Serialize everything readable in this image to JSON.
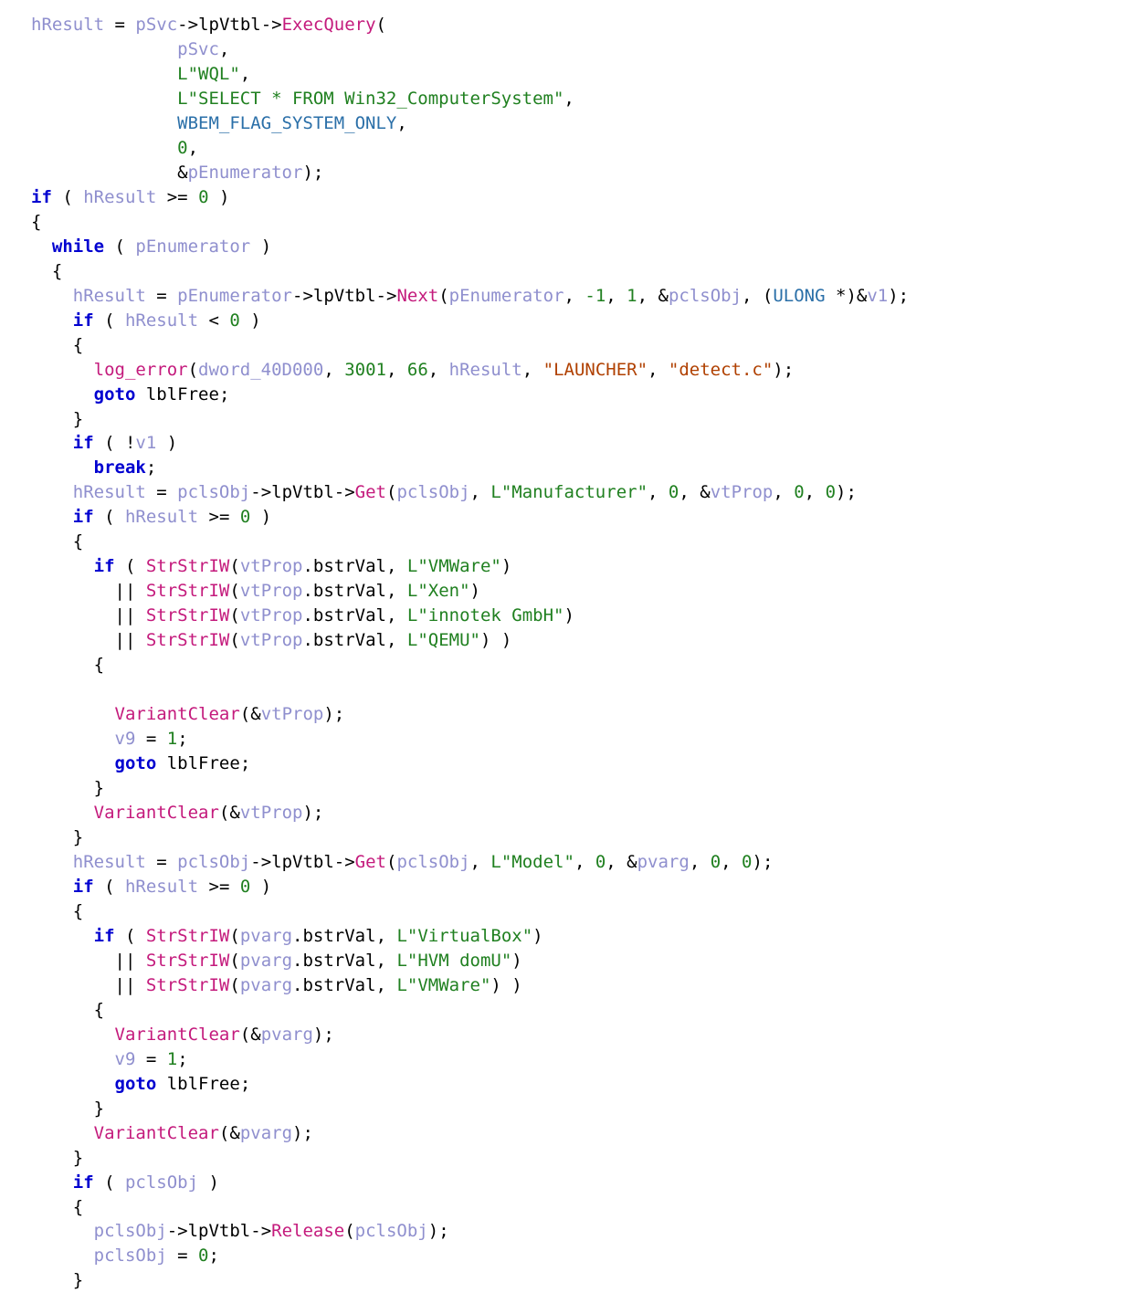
{
  "code": {
    "lines": [
      [
        {
          "t": "v",
          "s": "hResult"
        },
        {
          "t": "op",
          "s": " = "
        },
        {
          "t": "v",
          "s": "pSvc"
        },
        {
          "t": "op",
          "s": "->"
        },
        {
          "t": "mem",
          "s": "lpVtbl"
        },
        {
          "t": "op",
          "s": "->"
        },
        {
          "t": "fn",
          "s": "ExecQuery"
        },
        {
          "t": "op",
          "s": "("
        }
      ],
      [
        {
          "t": "op",
          "s": "              "
        },
        {
          "t": "v",
          "s": "pSvc"
        },
        {
          "t": "op",
          "s": ","
        }
      ],
      [
        {
          "t": "op",
          "s": "              "
        },
        {
          "t": "str",
          "s": "L\"WQL\""
        },
        {
          "t": "op",
          "s": ","
        }
      ],
      [
        {
          "t": "op",
          "s": "              "
        },
        {
          "t": "str",
          "s": "L\"SELECT * FROM Win32_ComputerSystem\""
        },
        {
          "t": "op",
          "s": ","
        }
      ],
      [
        {
          "t": "op",
          "s": "              "
        },
        {
          "t": "mac",
          "s": "WBEM_FLAG_SYSTEM_ONLY"
        },
        {
          "t": "op",
          "s": ","
        }
      ],
      [
        {
          "t": "op",
          "s": "              "
        },
        {
          "t": "num",
          "s": "0"
        },
        {
          "t": "op",
          "s": ","
        }
      ],
      [
        {
          "t": "op",
          "s": "              &"
        },
        {
          "t": "v",
          "s": "pEnumerator"
        },
        {
          "t": "op",
          "s": ");"
        }
      ],
      [
        {
          "t": "kw",
          "s": "if"
        },
        {
          "t": "op",
          "s": " ( "
        },
        {
          "t": "v",
          "s": "hResult"
        },
        {
          "t": "op",
          "s": " >= "
        },
        {
          "t": "num",
          "s": "0"
        },
        {
          "t": "op",
          "s": " )"
        }
      ],
      [
        {
          "t": "op",
          "s": "{"
        }
      ],
      [
        {
          "t": "op",
          "s": "  "
        },
        {
          "t": "kw",
          "s": "while"
        },
        {
          "t": "op",
          "s": " ( "
        },
        {
          "t": "v",
          "s": "pEnumerator"
        },
        {
          "t": "op",
          "s": " )"
        }
      ],
      [
        {
          "t": "op",
          "s": "  {"
        }
      ],
      [
        {
          "t": "op",
          "s": "    "
        },
        {
          "t": "v",
          "s": "hResult"
        },
        {
          "t": "op",
          "s": " = "
        },
        {
          "t": "v",
          "s": "pEnumerator"
        },
        {
          "t": "op",
          "s": "->"
        },
        {
          "t": "mem",
          "s": "lpVtbl"
        },
        {
          "t": "op",
          "s": "->"
        },
        {
          "t": "fn",
          "s": "Next"
        },
        {
          "t": "op",
          "s": "("
        },
        {
          "t": "v",
          "s": "pEnumerator"
        },
        {
          "t": "op",
          "s": ", "
        },
        {
          "t": "num",
          "s": "-1"
        },
        {
          "t": "op",
          "s": ", "
        },
        {
          "t": "num",
          "s": "1"
        },
        {
          "t": "op",
          "s": ", &"
        },
        {
          "t": "v",
          "s": "pclsObj"
        },
        {
          "t": "op",
          "s": ", ("
        },
        {
          "t": "ty",
          "s": "ULONG"
        },
        {
          "t": "op",
          "s": " *)&"
        },
        {
          "t": "v",
          "s": "v1"
        },
        {
          "t": "op",
          "s": ");"
        }
      ],
      [
        {
          "t": "op",
          "s": "    "
        },
        {
          "t": "kw",
          "s": "if"
        },
        {
          "t": "op",
          "s": " ( "
        },
        {
          "t": "v",
          "s": "hResult"
        },
        {
          "t": "op",
          "s": " < "
        },
        {
          "t": "num",
          "s": "0"
        },
        {
          "t": "op",
          "s": " )"
        }
      ],
      [
        {
          "t": "op",
          "s": "    {"
        }
      ],
      [
        {
          "t": "op",
          "s": "      "
        },
        {
          "t": "fn",
          "s": "log_error"
        },
        {
          "t": "op",
          "s": "("
        },
        {
          "t": "v",
          "s": "dword_40D000"
        },
        {
          "t": "op",
          "s": ", "
        },
        {
          "t": "num",
          "s": "3001"
        },
        {
          "t": "op",
          "s": ", "
        },
        {
          "t": "num",
          "s": "66"
        },
        {
          "t": "op",
          "s": ", "
        },
        {
          "t": "v",
          "s": "hResult"
        },
        {
          "t": "op",
          "s": ", "
        },
        {
          "t": "sstr",
          "s": "\"LAUNCHER\""
        },
        {
          "t": "op",
          "s": ", "
        },
        {
          "t": "sstr",
          "s": "\"detect.c\""
        },
        {
          "t": "op",
          "s": ");"
        }
      ],
      [
        {
          "t": "op",
          "s": "      "
        },
        {
          "t": "kw",
          "s": "goto"
        },
        {
          "t": "op",
          "s": " "
        },
        {
          "t": "lbl",
          "s": "lblFree"
        },
        {
          "t": "op",
          "s": ";"
        }
      ],
      [
        {
          "t": "op",
          "s": "    }"
        }
      ],
      [
        {
          "t": "op",
          "s": "    "
        },
        {
          "t": "kw",
          "s": "if"
        },
        {
          "t": "op",
          "s": " ( !"
        },
        {
          "t": "v",
          "s": "v1"
        },
        {
          "t": "op",
          "s": " )"
        }
      ],
      [
        {
          "t": "op",
          "s": "      "
        },
        {
          "t": "kw",
          "s": "break"
        },
        {
          "t": "op",
          "s": ";"
        }
      ],
      [
        {
          "t": "op",
          "s": "    "
        },
        {
          "t": "v",
          "s": "hResult"
        },
        {
          "t": "op",
          "s": " = "
        },
        {
          "t": "v",
          "s": "pclsObj"
        },
        {
          "t": "op",
          "s": "->"
        },
        {
          "t": "mem",
          "s": "lpVtbl"
        },
        {
          "t": "op",
          "s": "->"
        },
        {
          "t": "fn",
          "s": "Get"
        },
        {
          "t": "op",
          "s": "("
        },
        {
          "t": "v",
          "s": "pclsObj"
        },
        {
          "t": "op",
          "s": ", "
        },
        {
          "t": "str",
          "s": "L\"Manufacturer\""
        },
        {
          "t": "op",
          "s": ", "
        },
        {
          "t": "num",
          "s": "0"
        },
        {
          "t": "op",
          "s": ", &"
        },
        {
          "t": "v",
          "s": "vtProp"
        },
        {
          "t": "op",
          "s": ", "
        },
        {
          "t": "num",
          "s": "0"
        },
        {
          "t": "op",
          "s": ", "
        },
        {
          "t": "num",
          "s": "0"
        },
        {
          "t": "op",
          "s": ");"
        }
      ],
      [
        {
          "t": "op",
          "s": "    "
        },
        {
          "t": "kw",
          "s": "if"
        },
        {
          "t": "op",
          "s": " ( "
        },
        {
          "t": "v",
          "s": "hResult"
        },
        {
          "t": "op",
          "s": " >= "
        },
        {
          "t": "num",
          "s": "0"
        },
        {
          "t": "op",
          "s": " )"
        }
      ],
      [
        {
          "t": "op",
          "s": "    {"
        }
      ],
      [
        {
          "t": "op",
          "s": "      "
        },
        {
          "t": "kw",
          "s": "if"
        },
        {
          "t": "op",
          "s": " ( "
        },
        {
          "t": "fn",
          "s": "StrStrIW"
        },
        {
          "t": "op",
          "s": "("
        },
        {
          "t": "v",
          "s": "vtProp"
        },
        {
          "t": "op",
          "s": "."
        },
        {
          "t": "mem",
          "s": "bstrVal"
        },
        {
          "t": "op",
          "s": ", "
        },
        {
          "t": "str",
          "s": "L\"VMWare\""
        },
        {
          "t": "op",
          "s": ")"
        }
      ],
      [
        {
          "t": "op",
          "s": "        || "
        },
        {
          "t": "fn",
          "s": "StrStrIW"
        },
        {
          "t": "op",
          "s": "("
        },
        {
          "t": "v",
          "s": "vtProp"
        },
        {
          "t": "op",
          "s": "."
        },
        {
          "t": "mem",
          "s": "bstrVal"
        },
        {
          "t": "op",
          "s": ", "
        },
        {
          "t": "str",
          "s": "L\"Xen\""
        },
        {
          "t": "op",
          "s": ")"
        }
      ],
      [
        {
          "t": "op",
          "s": "        || "
        },
        {
          "t": "fn",
          "s": "StrStrIW"
        },
        {
          "t": "op",
          "s": "("
        },
        {
          "t": "v",
          "s": "vtProp"
        },
        {
          "t": "op",
          "s": "."
        },
        {
          "t": "mem",
          "s": "bstrVal"
        },
        {
          "t": "op",
          "s": ", "
        },
        {
          "t": "str",
          "s": "L\"innotek GmbH\""
        },
        {
          "t": "op",
          "s": ")"
        }
      ],
      [
        {
          "t": "op",
          "s": "        || "
        },
        {
          "t": "fn",
          "s": "StrStrIW"
        },
        {
          "t": "op",
          "s": "("
        },
        {
          "t": "v",
          "s": "vtProp"
        },
        {
          "t": "op",
          "s": "."
        },
        {
          "t": "mem",
          "s": "bstrVal"
        },
        {
          "t": "op",
          "s": ", "
        },
        {
          "t": "str",
          "s": "L\"QEMU\""
        },
        {
          "t": "op",
          "s": ") )"
        }
      ],
      [
        {
          "t": "op",
          "s": "      {"
        }
      ],
      [
        {
          "t": "op",
          "s": ""
        }
      ],
      [
        {
          "t": "op",
          "s": "        "
        },
        {
          "t": "fn",
          "s": "VariantClear"
        },
        {
          "t": "op",
          "s": "(&"
        },
        {
          "t": "v",
          "s": "vtProp"
        },
        {
          "t": "op",
          "s": ");"
        }
      ],
      [
        {
          "t": "op",
          "s": "        "
        },
        {
          "t": "v",
          "s": "v9"
        },
        {
          "t": "op",
          "s": " = "
        },
        {
          "t": "num",
          "s": "1"
        },
        {
          "t": "op",
          "s": ";"
        }
      ],
      [
        {
          "t": "op",
          "s": "        "
        },
        {
          "t": "kw",
          "s": "goto"
        },
        {
          "t": "op",
          "s": " "
        },
        {
          "t": "lbl",
          "s": "lblFree"
        },
        {
          "t": "op",
          "s": ";"
        }
      ],
      [
        {
          "t": "op",
          "s": "      }"
        }
      ],
      [
        {
          "t": "op",
          "s": "      "
        },
        {
          "t": "fn",
          "s": "VariantClear"
        },
        {
          "t": "op",
          "s": "(&"
        },
        {
          "t": "v",
          "s": "vtProp"
        },
        {
          "t": "op",
          "s": ");"
        }
      ],
      [
        {
          "t": "op",
          "s": "    }"
        }
      ],
      [
        {
          "t": "op",
          "s": "    "
        },
        {
          "t": "v",
          "s": "hResult"
        },
        {
          "t": "op",
          "s": " = "
        },
        {
          "t": "v",
          "s": "pclsObj"
        },
        {
          "t": "op",
          "s": "->"
        },
        {
          "t": "mem",
          "s": "lpVtbl"
        },
        {
          "t": "op",
          "s": "->"
        },
        {
          "t": "fn",
          "s": "Get"
        },
        {
          "t": "op",
          "s": "("
        },
        {
          "t": "v",
          "s": "pclsObj"
        },
        {
          "t": "op",
          "s": ", "
        },
        {
          "t": "str",
          "s": "L\"Model\""
        },
        {
          "t": "op",
          "s": ", "
        },
        {
          "t": "num",
          "s": "0"
        },
        {
          "t": "op",
          "s": ", &"
        },
        {
          "t": "v",
          "s": "pvarg"
        },
        {
          "t": "op",
          "s": ", "
        },
        {
          "t": "num",
          "s": "0"
        },
        {
          "t": "op",
          "s": ", "
        },
        {
          "t": "num",
          "s": "0"
        },
        {
          "t": "op",
          "s": ");"
        }
      ],
      [
        {
          "t": "op",
          "s": "    "
        },
        {
          "t": "kw",
          "s": "if"
        },
        {
          "t": "op",
          "s": " ( "
        },
        {
          "t": "v",
          "s": "hResult"
        },
        {
          "t": "op",
          "s": " >= "
        },
        {
          "t": "num",
          "s": "0"
        },
        {
          "t": "op",
          "s": " )"
        }
      ],
      [
        {
          "t": "op",
          "s": "    {"
        }
      ],
      [
        {
          "t": "op",
          "s": "      "
        },
        {
          "t": "kw",
          "s": "if"
        },
        {
          "t": "op",
          "s": " ( "
        },
        {
          "t": "fn",
          "s": "StrStrIW"
        },
        {
          "t": "op",
          "s": "("
        },
        {
          "t": "v",
          "s": "pvarg"
        },
        {
          "t": "op",
          "s": "."
        },
        {
          "t": "mem",
          "s": "bstrVal"
        },
        {
          "t": "op",
          "s": ", "
        },
        {
          "t": "str",
          "s": "L\"VirtualBox\""
        },
        {
          "t": "op",
          "s": ")"
        }
      ],
      [
        {
          "t": "op",
          "s": "        || "
        },
        {
          "t": "fn",
          "s": "StrStrIW"
        },
        {
          "t": "op",
          "s": "("
        },
        {
          "t": "v",
          "s": "pvarg"
        },
        {
          "t": "op",
          "s": "."
        },
        {
          "t": "mem",
          "s": "bstrVal"
        },
        {
          "t": "op",
          "s": ", "
        },
        {
          "t": "str",
          "s": "L\"HVM domU\""
        },
        {
          "t": "op",
          "s": ")"
        }
      ],
      [
        {
          "t": "op",
          "s": "        || "
        },
        {
          "t": "fn",
          "s": "StrStrIW"
        },
        {
          "t": "op",
          "s": "("
        },
        {
          "t": "v",
          "s": "pvarg"
        },
        {
          "t": "op",
          "s": "."
        },
        {
          "t": "mem",
          "s": "bstrVal"
        },
        {
          "t": "op",
          "s": ", "
        },
        {
          "t": "str",
          "s": "L\"VMWare\""
        },
        {
          "t": "op",
          "s": ") )"
        }
      ],
      [
        {
          "t": "op",
          "s": "      {"
        }
      ],
      [
        {
          "t": "op",
          "s": "        "
        },
        {
          "t": "fn",
          "s": "VariantClear"
        },
        {
          "t": "op",
          "s": "(&"
        },
        {
          "t": "v",
          "s": "pvarg"
        },
        {
          "t": "op",
          "s": ");"
        }
      ],
      [
        {
          "t": "op",
          "s": "        "
        },
        {
          "t": "v",
          "s": "v9"
        },
        {
          "t": "op",
          "s": " = "
        },
        {
          "t": "num",
          "s": "1"
        },
        {
          "t": "op",
          "s": ";"
        }
      ],
      [
        {
          "t": "op",
          "s": "        "
        },
        {
          "t": "kw",
          "s": "goto"
        },
        {
          "t": "op",
          "s": " "
        },
        {
          "t": "lbl",
          "s": "lblFree"
        },
        {
          "t": "op",
          "s": ";"
        }
      ],
      [
        {
          "t": "op",
          "s": "      }"
        }
      ],
      [
        {
          "t": "op",
          "s": "      "
        },
        {
          "t": "fn",
          "s": "VariantClear"
        },
        {
          "t": "op",
          "s": "(&"
        },
        {
          "t": "v",
          "s": "pvarg"
        },
        {
          "t": "op",
          "s": ");"
        }
      ],
      [
        {
          "t": "op",
          "s": "    }"
        }
      ],
      [
        {
          "t": "op",
          "s": "    "
        },
        {
          "t": "kw",
          "s": "if"
        },
        {
          "t": "op",
          "s": " ( "
        },
        {
          "t": "v",
          "s": "pclsObj"
        },
        {
          "t": "op",
          "s": " )"
        }
      ],
      [
        {
          "t": "op",
          "s": "    {"
        }
      ],
      [
        {
          "t": "op",
          "s": "      "
        },
        {
          "t": "v",
          "s": "pclsObj"
        },
        {
          "t": "op",
          "s": "->"
        },
        {
          "t": "mem",
          "s": "lpVtbl"
        },
        {
          "t": "op",
          "s": "->"
        },
        {
          "t": "fn",
          "s": "Release"
        },
        {
          "t": "op",
          "s": "("
        },
        {
          "t": "v",
          "s": "pclsObj"
        },
        {
          "t": "op",
          "s": ");"
        }
      ],
      [
        {
          "t": "op",
          "s": "      "
        },
        {
          "t": "v",
          "s": "pclsObj"
        },
        {
          "t": "op",
          "s": " = "
        },
        {
          "t": "num",
          "s": "0"
        },
        {
          "t": "op",
          "s": ";"
        }
      ],
      [
        {
          "t": "op",
          "s": "    }"
        }
      ]
    ]
  }
}
